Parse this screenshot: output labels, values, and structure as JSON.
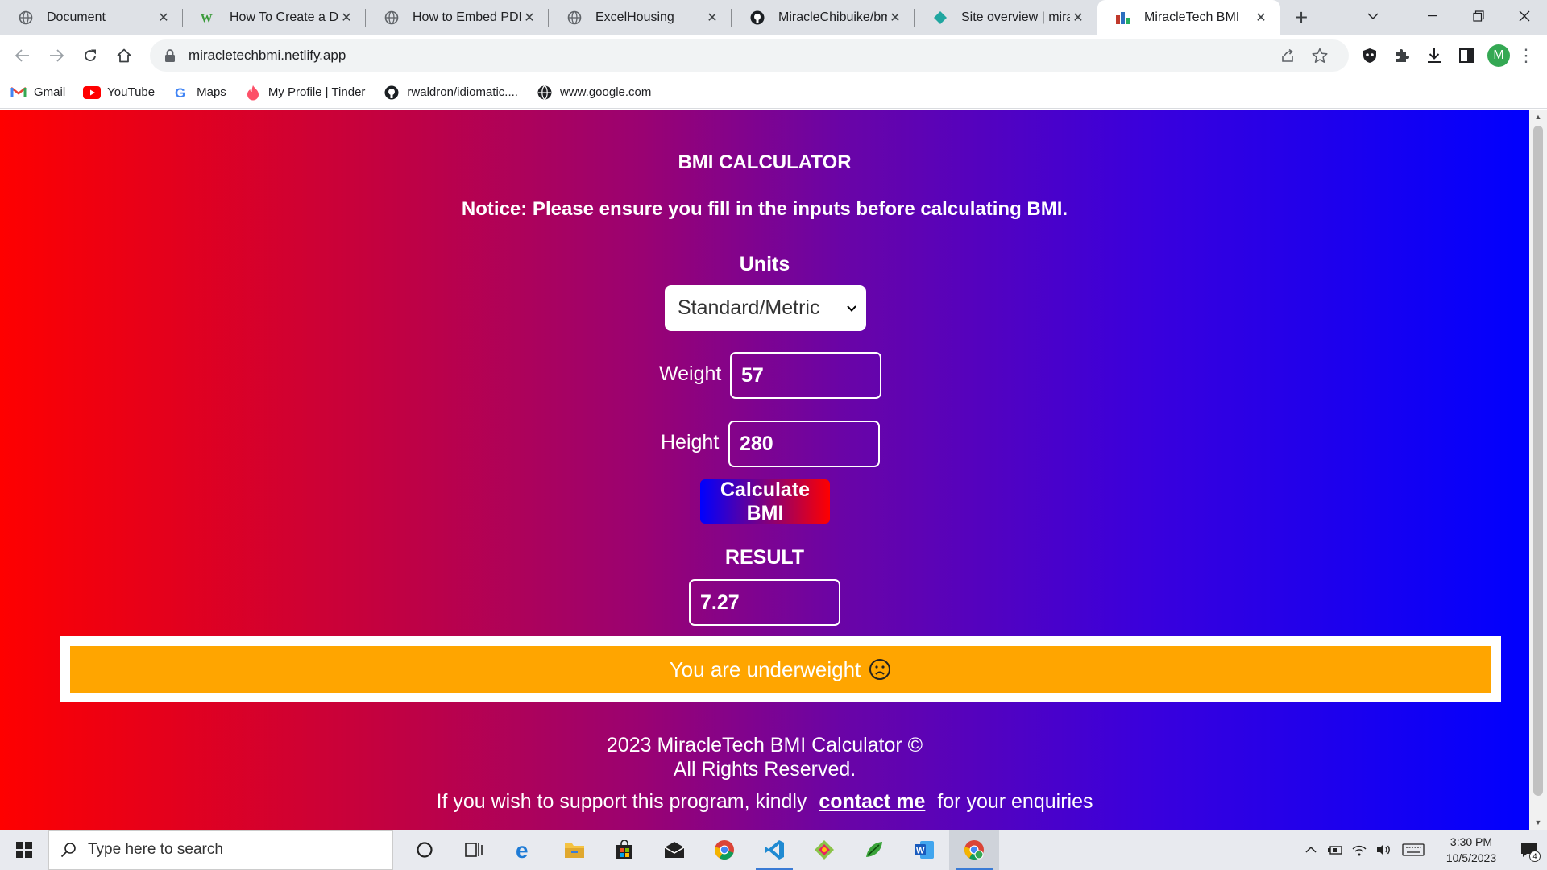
{
  "browser": {
    "tabs": [
      {
        "title": "Document",
        "icon": "globe-icon",
        "active": false
      },
      {
        "title": "How To Create a Dow",
        "icon": "wikihow-icon",
        "active": false
      },
      {
        "title": "How to Embed PDF f",
        "icon": "globe-icon",
        "active": false
      },
      {
        "title": "ExcelHousing",
        "icon": "globe-icon",
        "active": false
      },
      {
        "title": "MiracleChibuike/bmi",
        "icon": "github-icon",
        "active": false
      },
      {
        "title": "Site overview | mirac",
        "icon": "netlify-icon",
        "active": false
      },
      {
        "title": "MiracleTech BMI",
        "icon": "site-favicon",
        "active": true
      }
    ],
    "address_url": "miracletechbmi.netlify.app",
    "profile_initial": "M",
    "bookmarks": [
      {
        "label": "Gmail",
        "icon": "gmail-icon"
      },
      {
        "label": "YouTube",
        "icon": "youtube-icon"
      },
      {
        "label": "Maps",
        "icon": "google-icon"
      },
      {
        "label": "My Profile | Tinder",
        "icon": "tinder-icon"
      },
      {
        "label": "rwaldron/idiomatic....",
        "icon": "github-icon"
      },
      {
        "label": "www.google.com",
        "icon": "globe-icon"
      }
    ]
  },
  "page": {
    "title": "BMI CALCULATOR",
    "notice": "Notice: Please ensure you fill in the inputs before calculating BMI.",
    "units_label": "Units",
    "units_selected": "Standard/Metric",
    "weight_label": "Weight",
    "weight_value": "57",
    "height_label": "Height",
    "height_value": "280",
    "calculate_label": "Calculate BMI",
    "result_label": "RESULT",
    "result_value": "7.27",
    "status_message": "You are underweight",
    "footer_line1": "2023 MiracleTech BMI Calculator ©",
    "footer_line2": "All Rights Reserved.",
    "support_prefix": "If you wish to support this program, kindly",
    "support_link": "contact me",
    "support_suffix": "for your enquiries",
    "colors": {
      "gradient_left": "#fe0000",
      "gradient_right": "#0000fe",
      "banner": "#ffa500"
    }
  },
  "taskbar": {
    "search_placeholder": "Type here to search",
    "apps": [
      "cortana-icon",
      "task-view-icon",
      "edge-icon",
      "file-explorer-icon",
      "store-icon",
      "mail-icon",
      "chrome-icon",
      "vscode-icon",
      "gitkraken-icon",
      "app-icon",
      "word-icon",
      "chrome-profile-icon"
    ],
    "time": "3:30 PM",
    "date": "10/5/2023",
    "notification_count": "4"
  }
}
